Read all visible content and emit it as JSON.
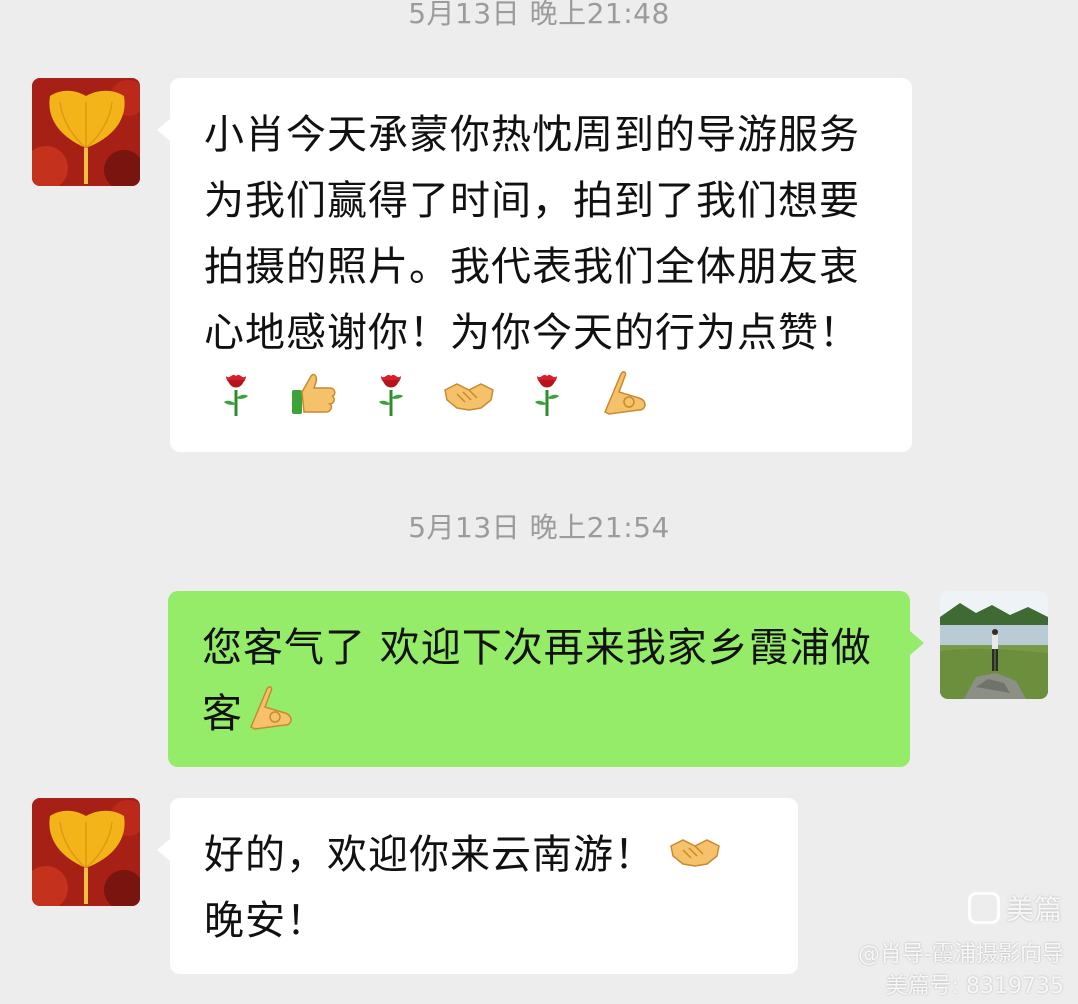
{
  "timestamps": {
    "first": "5月13日 晚上21:48",
    "second": "5月13日 晚上21:54"
  },
  "messages": [
    {
      "side": "left",
      "avatar": "ginkgo-leaf-avatar",
      "text": "小肖今天承蒙你热忱周到的导游服务为我们赢得了时间，拍到了我们想要拍摄的照片。我代表我们全体朋友衷心地感谢你！为你今天的行为点赞！",
      "emojis": [
        "rose-icon",
        "thumbs-up-icon",
        "rose-icon",
        "handshake-icon",
        "rose-icon",
        "ok-hand-icon"
      ]
    },
    {
      "side": "right",
      "avatar": "lakeside-photo-avatar",
      "text": "您客气了 欢迎下次再来我家乡霞浦做客",
      "emojis": [
        "ok-hand-icon"
      ]
    },
    {
      "side": "left",
      "avatar": "ginkgo-leaf-avatar",
      "text": "好的，欢迎你来云南游！",
      "text2": "晚安！",
      "emojis": [
        "handshake-icon"
      ]
    }
  ],
  "watermark": {
    "brand": "美篇",
    "author": "@肖导-霞浦摄影向导",
    "id": "美篇号: 8319735"
  },
  "colors": {
    "background": "#ededed",
    "incoming_bubble": "#ffffff",
    "outgoing_bubble": "#95ec69",
    "timestamp_text": "#9b9b9b"
  }
}
